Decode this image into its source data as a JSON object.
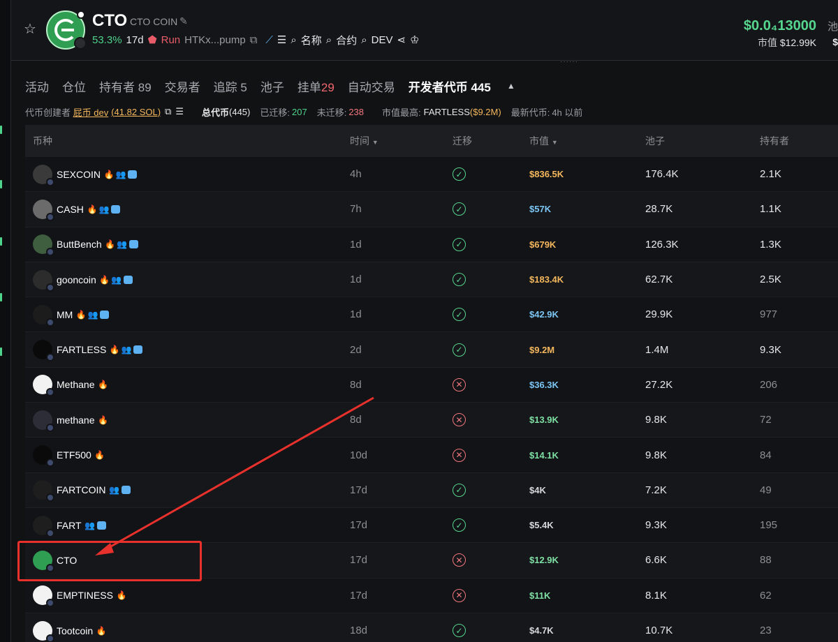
{
  "header": {
    "title": "CTO",
    "subtitle": "CTO COIN",
    "change": "53.3%",
    "age": "17d",
    "run_label": "Run",
    "address": "HTKx...pump",
    "search_name": "名称",
    "search_contract": "合约",
    "search_dev": "DEV",
    "price": "$0.0₄13000",
    "mcap_label": "市值",
    "mcap_value": "$12.99K",
    "edge_label": "池",
    "edge_value": "$"
  },
  "tabs": [
    {
      "label": "活动",
      "count": ""
    },
    {
      "label": "仓位",
      "count": ""
    },
    {
      "label": "持有者",
      "count": "89"
    },
    {
      "label": "交易者",
      "count": ""
    },
    {
      "label": "追踪",
      "count": "5"
    },
    {
      "label": "池子",
      "count": ""
    },
    {
      "label": "挂单",
      "count": "29"
    },
    {
      "label": "自动交易",
      "count": ""
    },
    {
      "label": "开发者代币",
      "count": "445"
    }
  ],
  "infobar": {
    "creator_label": "代币创建者",
    "creator_name": "屁币 dev",
    "creator_sol": "(41.82 SOL)",
    "total_label": "总代币",
    "total_value": "(445)",
    "migrated_label": "已迁移:",
    "migrated_value": "207",
    "unmigrated_label": "未迁移:",
    "unmigrated_value": "238",
    "top_label": "市值最高:",
    "top_name": "FARTLESS",
    "top_value": "($9.2M)",
    "latest_label": "最新代币:",
    "latest_value": "4h 以前"
  },
  "table": {
    "columns": {
      "coin": "币种",
      "time": "时间",
      "migrated": "迁移",
      "mcap": "市值",
      "pool": "池子",
      "holders": "持有者"
    },
    "rows": [
      {
        "name": "SEXCOIN",
        "time": "4h",
        "migrated": true,
        "mcap": "$836.5K",
        "mcap_color": "#f4b75d",
        "pool": "176.4K",
        "holders": "2.1K",
        "badges": [
          "fire",
          "people",
          "chat"
        ],
        "avatar": "#3a3a3a"
      },
      {
        "name": "CASH",
        "time": "7h",
        "migrated": true,
        "mcap": "$57K",
        "mcap_color": "#7cc6f5",
        "pool": "28.7K",
        "holders": "1.1K",
        "badges": [
          "fire",
          "people",
          "chat"
        ],
        "avatar": "#6b6b6b"
      },
      {
        "name": "ButtBench",
        "time": "1d",
        "migrated": true,
        "mcap": "$679K",
        "mcap_color": "#f4b75d",
        "pool": "126.3K",
        "holders": "1.3K",
        "badges": [
          "fire",
          "people",
          "chat"
        ],
        "avatar": "#3f5e3f"
      },
      {
        "name": "gooncoin",
        "time": "1d",
        "migrated": true,
        "mcap": "$183.4K",
        "mcap_color": "#f4b75d",
        "pool": "62.7K",
        "holders": "2.5K",
        "badges": [
          "fire",
          "people",
          "chat"
        ],
        "avatar": "#2c2c2c"
      },
      {
        "name": "MM",
        "time": "1d",
        "migrated": true,
        "mcap": "$42.9K",
        "mcap_color": "#7cc6f5",
        "pool": "29.9K",
        "holders": "977",
        "badges": [
          "fire",
          "people",
          "chat"
        ],
        "avatar": "#1c1c1c"
      },
      {
        "name": "FARTLESS",
        "time": "2d",
        "migrated": true,
        "mcap": "$9.2M",
        "mcap_color": "#f4b75d",
        "pool": "1.4M",
        "holders": "9.3K",
        "badges": [
          "fire",
          "people",
          "chat"
        ],
        "avatar": "#0a0a0a"
      },
      {
        "name": "Methane",
        "time": "8d",
        "migrated": false,
        "mcap": "$36.3K",
        "mcap_color": "#7cc6f5",
        "pool": "27.2K",
        "holders": "206",
        "badges": [
          "fire"
        ],
        "avatar": "#f2f2f2"
      },
      {
        "name": "methane",
        "time": "8d",
        "migrated": false,
        "mcap": "$13.9K",
        "mcap_color": "#7fe0a4",
        "pool": "9.8K",
        "holders": "72",
        "badges": [
          "fire"
        ],
        "avatar": "#2d2d38"
      },
      {
        "name": "ETF500",
        "time": "10d",
        "migrated": false,
        "mcap": "$14.1K",
        "mcap_color": "#7fe0a4",
        "pool": "9.8K",
        "holders": "84",
        "badges": [
          "fire"
        ],
        "avatar": "#0a0a0a"
      },
      {
        "name": "FARTCOIN",
        "time": "17d",
        "migrated": true,
        "mcap": "$4K",
        "mcap_color": "#d8d8da",
        "pool": "7.2K",
        "holders": "49",
        "badges": [
          "people",
          "chat"
        ],
        "avatar": "#1e1e1e"
      },
      {
        "name": "FART",
        "time": "17d",
        "migrated": true,
        "mcap": "$5.4K",
        "mcap_color": "#d8d8da",
        "pool": "9.3K",
        "holders": "195",
        "badges": [
          "people",
          "chat"
        ],
        "avatar": "#1e1e1e"
      },
      {
        "name": "CTO",
        "time": "17d",
        "migrated": false,
        "mcap": "$12.9K",
        "mcap_color": "#7fe0a4",
        "pool": "6.6K",
        "holders": "88",
        "badges": [],
        "avatar": "#2f9d52"
      },
      {
        "name": "EMPTINESS",
        "time": "17d",
        "migrated": false,
        "mcap": "$11K",
        "mcap_color": "#7fe0a4",
        "pool": "8.1K",
        "holders": "62",
        "badges": [
          "fire"
        ],
        "avatar": "#f2f2f2"
      },
      {
        "name": "Tootcoin",
        "time": "18d",
        "migrated": true,
        "mcap": "$4.7K",
        "mcap_color": "#d8d8da",
        "pool": "10.7K",
        "holders": "23",
        "badges": [
          "fire"
        ],
        "avatar": "#f2f2f2"
      }
    ]
  },
  "colors": {
    "accent_green": "#56d68f",
    "annotation_red": "#e8312c"
  }
}
